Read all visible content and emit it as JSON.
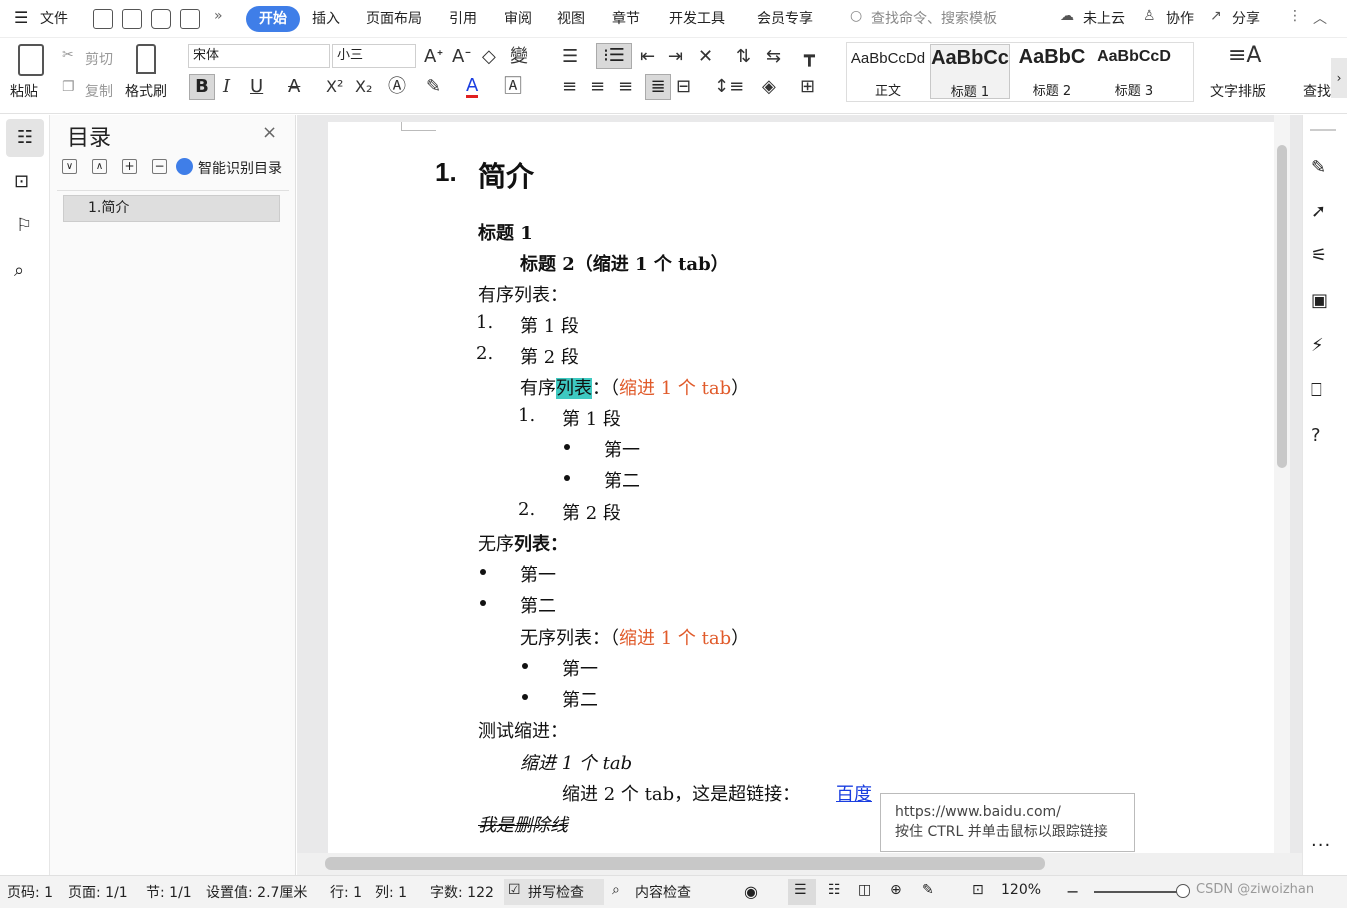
{
  "menu": {
    "file": "文件",
    "tabs": [
      "开始",
      "插入",
      "页面布局",
      "引用",
      "审阅",
      "视图",
      "章节",
      "开发工具",
      "会员专享"
    ],
    "search_placeholder": "查找命令、搜索模板",
    "cloud": "未上云",
    "collab": "协作",
    "share": "分享"
  },
  "ribbon": {
    "paste": "粘贴",
    "cut": "剪切",
    "copy": "复制",
    "format_painter": "格式刷",
    "font_name": "宋体",
    "font_size": "小三",
    "bold": "B",
    "italic": "I",
    "underline": "U",
    "strike": "A",
    "superscript": "X²",
    "subscript": "X₂",
    "font_color": "A",
    "styles": [
      {
        "sample": "AaBbCcDd",
        "name": "正文"
      },
      {
        "sample": "AaBbCc",
        "name": "标题 1"
      },
      {
        "sample": "AaBbC",
        "name": "标题 2"
      },
      {
        "sample": "AaBbCcD",
        "name": "标题 3"
      }
    ],
    "text_layout": "文字排版",
    "find": "查找"
  },
  "toc": {
    "title": "目录",
    "smart": "智能识别目录",
    "items": [
      "1.简介"
    ]
  },
  "doc": {
    "h1_num": "1.",
    "h1_text": "简介",
    "lines": {
      "t1": "标题 1",
      "t2": "标题 2（缩进 1 个 tab）",
      "ol": "有序列表：",
      "ol1n": "1.",
      "ol1": "第 1 段",
      "ol2n": "2.",
      "ol2": "第 2 段",
      "ol_in_a": "有序",
      "ol_in_b": "列表",
      "ol_in_c": "：（",
      "ol_in_red": "缩进 1 个 tab",
      "ol_in_d": "）",
      "sub1n": "1.",
      "sub1": "第 1 段",
      "ul_in1": "第一",
      "ul_in2": "第二",
      "sub2n": "2.",
      "sub2": "第 2 段",
      "ul_a": "无序",
      "ul_b": "列表：",
      "ul1": "第一",
      "ul2": "第二",
      "ul_in_a": "无序列表：（",
      "ul_in_red": "缩进 1 个 tab",
      "ul_in_d": "）",
      "ti": "测试缩进：",
      "i1": "缩进 1 个 tab",
      "i2": "缩进 2 个 tab，这是超链接：",
      "link": "百度",
      "del": "我是删除线"
    }
  },
  "tooltip": {
    "url": "https://www.baidu.com/",
    "hint": "按住 CTRL 并单击鼠标以跟踪链接"
  },
  "status": {
    "page": "页码: 1",
    "pages": "页面: 1/1",
    "section": "节: 1/1",
    "setting": "设置值: 2.7厘米",
    "row": "行: 1",
    "col": "列: 1",
    "words": "字数: 122",
    "spell": "拼写检查",
    "content": "内容检查",
    "zoom": "120%",
    "watermark": "CSDN @ziwoizhan"
  },
  "colors": {
    "accent": "#3f7ee8",
    "red": "#e05a2a",
    "highlight": "#3ec9c1",
    "link": "#1a3ee0"
  }
}
